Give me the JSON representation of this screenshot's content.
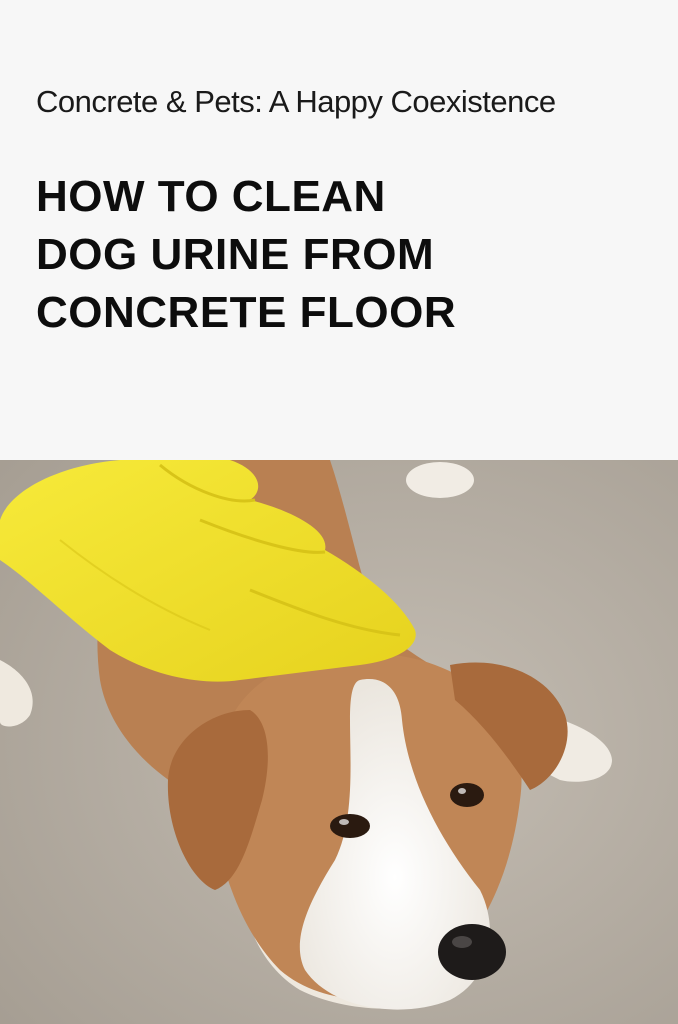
{
  "header": {
    "subtitle": "Concrete & Pets: A Happy Coexistence",
    "title_lines": [
      "HOW TO CLEAN",
      "DOG URINE FROM",
      "CONCRETE FLOOR"
    ]
  },
  "photo": {
    "subject": "dog-with-yellow-glove",
    "colors": {
      "concrete": "#b3aca2",
      "glove": "#f2e22f",
      "dog_brown": "#b97d4d",
      "dog_white": "#f4f1ec"
    }
  }
}
